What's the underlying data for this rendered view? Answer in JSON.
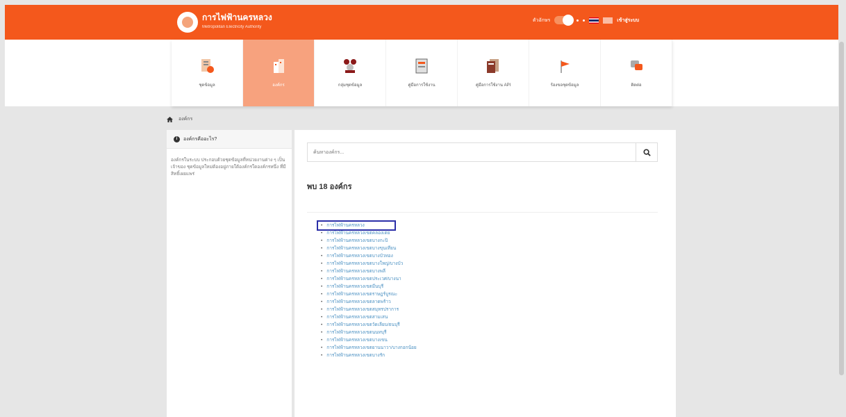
{
  "header": {
    "logo_title": "การไฟฟ้านครหลวง",
    "logo_subtitle": "Metropolitan Electricity Authority",
    "toggle_label": "ตัวอักษร",
    "lang_th": "TH",
    "lang_en": "EN",
    "login_label": "เข้าสู่ระบบ"
  },
  "nav": [
    {
      "label": "ชุดข้อมูล",
      "icon": "dataset-icon",
      "active": false
    },
    {
      "label": "องค์กร",
      "icon": "building-icon",
      "active": true
    },
    {
      "label": "กลุ่มชุดข้อมูล",
      "icon": "groups-icon",
      "active": false
    },
    {
      "label": "คู่มือการใช้งาน",
      "icon": "manual-icon",
      "active": false
    },
    {
      "label": "คู่มือการใช้งาน API",
      "icon": "api-manual-icon",
      "active": false
    },
    {
      "label": "ร้องขอชุดข้อมูล",
      "icon": "request-icon",
      "active": false
    },
    {
      "label": "ติดต่อ",
      "icon": "contact-icon",
      "active": false
    }
  ],
  "breadcrumb": {
    "current": "องค์กร"
  },
  "sidebar": {
    "title": "องค์กรคืออะไร?",
    "text": "องค์กรในระบบ ประกอบด้วยชุดข้อมูลที่หน่วยงานต่าง ๆ เป็นเจ้าของ ชุดข้อมูลใหม่ต้องอยู่ภายใต้องค์กรใดองค์กรหนึ่ง ที่มีสิทธิ์เผยแพร่"
  },
  "search": {
    "placeholder": "ค้นหาองค์กร..."
  },
  "results_summary": "พบ 18 องค์กร",
  "organizations": [
    "การไฟฟ้านครหลวง",
    "การไฟฟ้านครหลวงเขตคลองเตย",
    "การไฟฟ้านครหลวงเขตบางกะปิ",
    "การไฟฟ้านครหลวงเขตบางขุนเทียน",
    "การไฟฟ้านครหลวงเขตบางบัวทอง",
    "การไฟฟ้านครหลวงเขตบางใหญ่/บางบัว",
    "การไฟฟ้านครหลวงเขตบางพลี",
    "การไฟฟ้านครหลวงเขตประเวศ/บางนา",
    "การไฟฟ้านครหลวงเขตมีนบุรี",
    "การไฟฟ้านครหลวงเขตราษฎร์บูรณะ",
    "การไฟฟ้านครหลวงเขตลาดพร้าว",
    "การไฟฟ้านครหลวงเขตสมุทรปราการ",
    "การไฟฟ้านครหลวงเขตสามเสน",
    "การไฟฟ้านครหลวงเขตวัดเลียบ/ธนบุรี",
    "การไฟฟ้านครหลวงเขตนนทบุรี",
    "การไฟฟ้านครหลวงเขตบางเขน",
    "การไฟฟ้านครหลวงเขตยานนาวา/บางกอกน้อย",
    "การไฟฟ้านครหลวงเขตบางรัก"
  ]
}
